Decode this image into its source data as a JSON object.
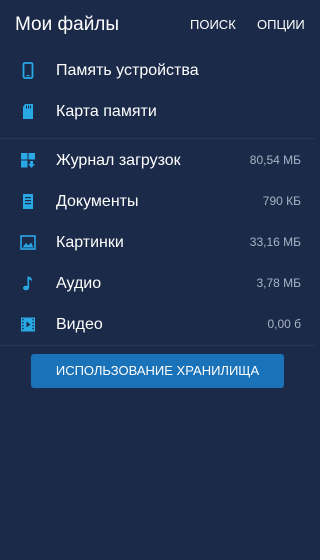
{
  "header": {
    "title": "Мои файлы",
    "search_label": "ПОИСК",
    "options_label": "ОПЦИИ"
  },
  "storage": [
    {
      "label": "Память устройства",
      "icon": "phone-icon"
    },
    {
      "label": "Карта памяти",
      "icon": "sd-card-icon"
    }
  ],
  "categories": [
    {
      "label": "Журнал загрузок",
      "size": "80,54 МБ",
      "icon": "download-history-icon"
    },
    {
      "label": "Документы",
      "size": "790 КБ",
      "icon": "document-icon"
    },
    {
      "label": "Картинки",
      "size": "33,16 МБ",
      "icon": "image-icon"
    },
    {
      "label": "Аудио",
      "size": "3,78 МБ",
      "icon": "music-note-icon"
    },
    {
      "label": "Видео",
      "size": "0,00 б",
      "icon": "video-icon"
    }
  ],
  "storage_usage_button": "ИСПОЛЬЗОВАНИЕ ХРАНИЛИЩА",
  "colors": {
    "background": "#1b2a48",
    "icon": "#29a8e6",
    "button": "#1a72b8",
    "secondary_text": "#a9b3c6"
  }
}
